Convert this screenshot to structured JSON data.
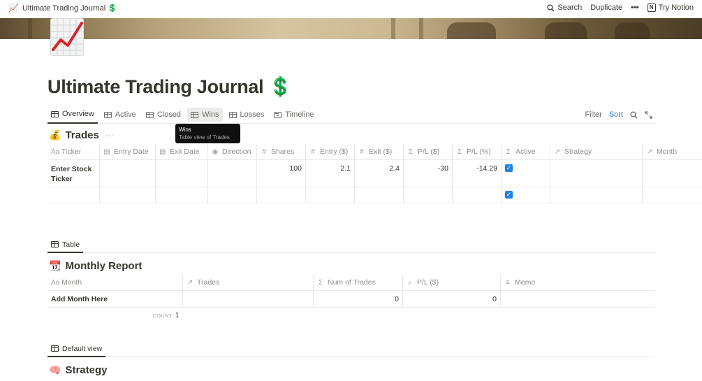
{
  "topbar": {
    "breadcrumb_emoji": "📈",
    "breadcrumb_title": "Ultimate Trading Journal 💲",
    "search_label": "Search",
    "duplicate_label": "Duplicate",
    "more_label": "•••",
    "try_notion_label": "Try Notion",
    "notion_logo": "N"
  },
  "page": {
    "title": "Ultimate Trading Journal 💲",
    "icon": "chart-increasing-icon"
  },
  "tabs": [
    {
      "label": "Overview",
      "icon": "table-icon",
      "active": true
    },
    {
      "label": "Active",
      "icon": "table-icon"
    },
    {
      "label": "Closed",
      "icon": "table-icon"
    },
    {
      "label": "Wins",
      "icon": "table-icon",
      "hover": true
    },
    {
      "label": "Losses",
      "icon": "table-icon"
    },
    {
      "label": "Timeline",
      "icon": "timeline-icon"
    }
  ],
  "toolbar": {
    "filter_label": "Filter",
    "sort_label": "Sort"
  },
  "tooltip": {
    "title": "Wins",
    "subtitle": "Table view of Trades"
  },
  "trades": {
    "emoji": "💰",
    "title": "Trades",
    "more": "···",
    "columns": [
      {
        "label": "Ticker",
        "icon": "Aa"
      },
      {
        "label": "Entry Date",
        "icon": "calendar-icon"
      },
      {
        "label": "Exit Date",
        "icon": "calendar-icon"
      },
      {
        "label": "Direction",
        "icon": "select-icon"
      },
      {
        "label": "Shares",
        "icon": "#"
      },
      {
        "label": "Entry ($)",
        "icon": "#"
      },
      {
        "label": "Exit ($)",
        "icon": "#"
      },
      {
        "label": "P/L ($)",
        "icon": "Σ"
      },
      {
        "label": "P/L (%)",
        "icon": "Σ"
      },
      {
        "label": "Active",
        "icon": "Σ"
      },
      {
        "label": "Strategy",
        "icon": "↗"
      },
      {
        "label": "Month",
        "icon": "↗"
      }
    ],
    "rows": [
      {
        "ticker": "Enter Stock Ticker",
        "entry_date": "",
        "exit_date": "",
        "direction": "",
        "shares": "100",
        "entry": "2.1",
        "exit": "2.4",
        "pl": "-30",
        "pl_pct": "-14.29",
        "active": "✓",
        "strategy": "",
        "month": ""
      },
      {
        "ticker": "",
        "entry_date": "",
        "exit_date": "",
        "direction": "",
        "shares": "",
        "entry": "",
        "exit": "",
        "pl": "",
        "pl_pct": "",
        "active": "✓",
        "strategy": "",
        "month": ""
      }
    ]
  },
  "monthly": {
    "view_label": "Table",
    "emoji": "📆",
    "title": "Monthly Report",
    "columns": [
      {
        "label": "Month",
        "icon": "Aa"
      },
      {
        "label": "Trades",
        "icon": "↗"
      },
      {
        "label": "Num of Trades",
        "icon": "Σ"
      },
      {
        "label": "P/L ($)",
        "icon": "search-icon"
      },
      {
        "label": "Memo",
        "icon": "≡"
      }
    ],
    "rows": [
      {
        "month": "Add Month Here",
        "trades": "",
        "num_trades": "0",
        "pl": "0",
        "memo": ""
      }
    ],
    "count_label": "COUNT",
    "count_value": "1"
  },
  "strategy": {
    "view_label": "Default view",
    "emoji": "🧠",
    "title": "Strategy"
  }
}
